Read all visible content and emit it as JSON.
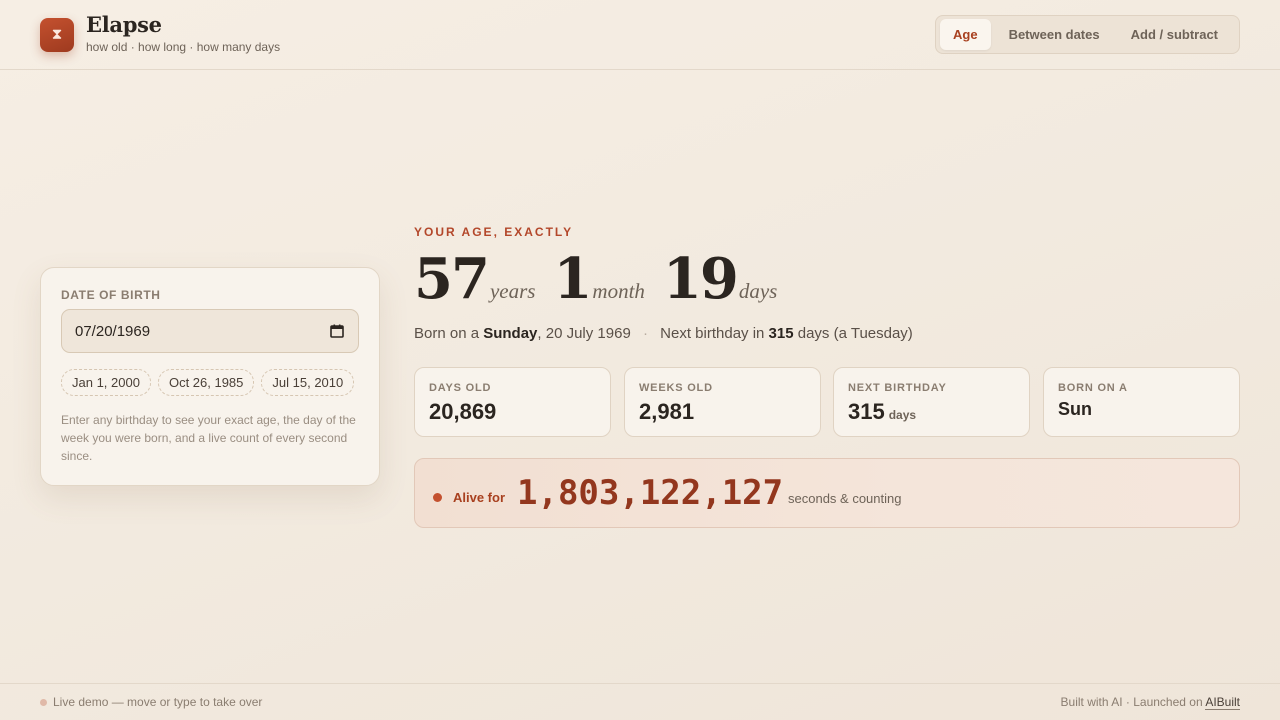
{
  "brand": {
    "logo_icon": "hourglass-icon",
    "title": "Elapse",
    "subtitle": "how old · how long · how many days"
  },
  "tabs": [
    {
      "label": "Age",
      "active": true
    },
    {
      "label": "Between dates",
      "active": false
    },
    {
      "label": "Add / subtract",
      "active": false
    }
  ],
  "input_card": {
    "label": "DATE OF BIRTH",
    "date_value": "07/20/1969",
    "calendar_icon": "calendar-icon",
    "presets": [
      "Jan 1, 2000",
      "Oct 26, 1985",
      "Jul 15, 2010"
    ],
    "help": "Enter any birthday to see your exact age, the day of the week you were born, and a live count of every second since."
  },
  "result": {
    "eyebrow": "YOUR AGE, EXACTLY",
    "years": "57",
    "years_unit": "years",
    "months": "1",
    "months_unit": "month",
    "days": "19",
    "days_unit": "days",
    "summary": {
      "born_prefix": "Born on a",
      "weekday": "Sunday",
      "born_date": ", 20 July 1969",
      "separator": "·",
      "next_prefix": "Next birthday in",
      "next_days": "315",
      "next_suffix": "days (a Tuesday)"
    }
  },
  "stats": [
    {
      "label": "DAYS OLD",
      "value": "20,869",
      "unit": ""
    },
    {
      "label": "WEEKS OLD",
      "value": "2,981",
      "unit": ""
    },
    {
      "label": "NEXT BIRTHDAY",
      "value": "315",
      "unit": "days"
    },
    {
      "label": "BORN ON A",
      "value": "Sun",
      "unit": ""
    }
  ],
  "alive": {
    "label": "Alive for",
    "count": "1,803,122,127",
    "suffix": "seconds & counting"
  },
  "footer": {
    "left": "Live demo — move or type to take over",
    "right_prefix": "Built with AI · Launched on",
    "right_link": "AIBuilt"
  },
  "colors": {
    "accent": "#b3472a",
    "background": "#f3ebe0",
    "text": "#2b2520"
  }
}
